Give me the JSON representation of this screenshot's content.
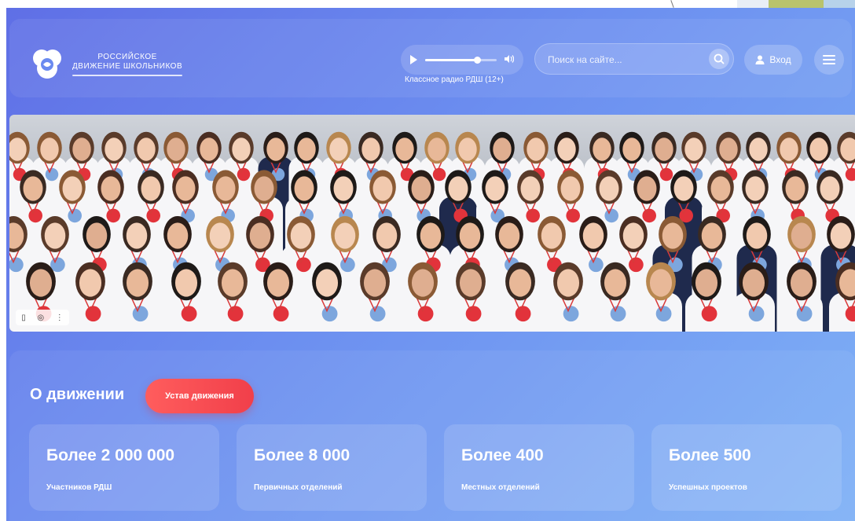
{
  "header": {
    "logo_line1": "Российское",
    "logo_line2": "Движение школьников",
    "radio_label": "Классное радио РДШ (12+)",
    "radio_progress": 0.72,
    "search_placeholder": "Поиск на сайте...",
    "login_label": "Вход",
    "icons": [
      "play-icon",
      "volume-icon",
      "search-icon",
      "user-icon",
      "hamburger-menu-icon"
    ]
  },
  "hero": {
    "tools": [
      "bookmark-icon",
      "camera-icon",
      "more-icon"
    ]
  },
  "about": {
    "title": "О движении",
    "charter_button": "Устав движения",
    "stats": [
      {
        "value": "Более 2 000 000",
        "label": "Участников РДШ"
      },
      {
        "value": "Более 8 000",
        "label": "Первичных отделений"
      },
      {
        "value": "Более 400",
        "label": "Местных отделений"
      },
      {
        "value": "Более 500",
        "label": "Успешных проектов"
      }
    ]
  },
  "colors": {
    "accent_red": "#f13f4a",
    "bg_start": "#5f6fe6",
    "bg_end": "#7fb1f6"
  }
}
